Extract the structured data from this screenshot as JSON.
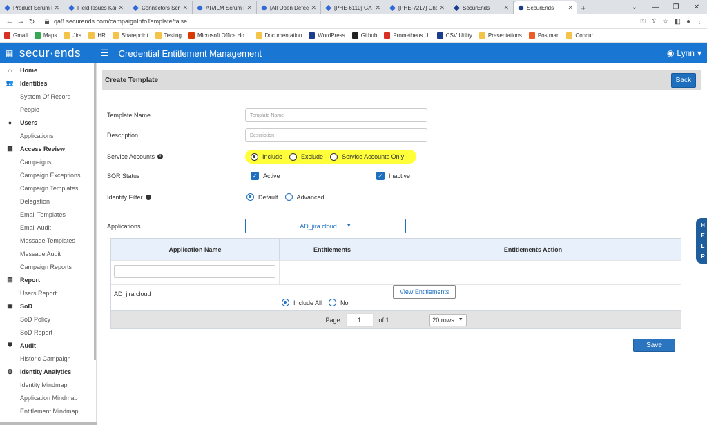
{
  "browser": {
    "tabs": [
      {
        "title": "Product Scrum B",
        "color": "#2f6bd6"
      },
      {
        "title": "Field Issues Kanb",
        "color": "#2f6bd6"
      },
      {
        "title": "Connectors Scrum",
        "color": "#2f6bd6"
      },
      {
        "title": "AR/ILM Scrum Bo",
        "color": "#2f6bd6"
      },
      {
        "title": "[All Open Defects",
        "color": "#2f6bd6"
      },
      {
        "title": "[PHE-6110] GA ar",
        "color": "#2f6bd6"
      },
      {
        "title": "[PHE-7217] Chan",
        "color": "#2f6bd6"
      },
      {
        "title": "SecurEnds",
        "color": "#1a3d8f"
      },
      {
        "title": "SecurEnds",
        "color": "#1a3d8f",
        "active": true
      }
    ],
    "new_tab": "+",
    "url": "qa8.securends.com/campaignInfoTemplate/false",
    "bookmarks": [
      {
        "label": "Gmail",
        "color": "#d93025"
      },
      {
        "label": "Maps",
        "color": "#34a853"
      },
      {
        "label": "Jira",
        "color": "#f4c34a"
      },
      {
        "label": "HR",
        "color": "#f4c34a"
      },
      {
        "label": "Sharepoint",
        "color": "#f4c34a"
      },
      {
        "label": "Testing",
        "color": "#f4c34a"
      },
      {
        "label": "Microsoft Office Ho...",
        "color": "#d83b01"
      },
      {
        "label": "Documentation",
        "color": "#f4c34a"
      },
      {
        "label": "WordPress",
        "color": "#1a3d8f"
      },
      {
        "label": "Github",
        "color": "#222222"
      },
      {
        "label": "Prometheus UI",
        "color": "#d93025"
      },
      {
        "label": "CSV Utility",
        "color": "#1a3d8f"
      },
      {
        "label": "Presentations",
        "color": "#f4c34a"
      },
      {
        "label": "Postman",
        "color": "#ef5b25"
      },
      {
        "label": "Concur",
        "color": "#f4c34a"
      }
    ]
  },
  "app": {
    "brand": "secur·ends",
    "title": "Credential Entitlement Management",
    "user": "Lynn"
  },
  "sidebar": [
    {
      "label": "Home",
      "head": true,
      "icon": "home-icon",
      "glyph": "⌂"
    },
    {
      "label": "Identities",
      "head": true,
      "icon": "users-icon",
      "glyph": "👥"
    },
    {
      "label": "System Of Record"
    },
    {
      "label": "People"
    },
    {
      "label": "Users",
      "head": true,
      "icon": "user-icon",
      "glyph": "●"
    },
    {
      "label": "Applications"
    },
    {
      "label": "Access Review",
      "head": true,
      "icon": "grid-icon",
      "glyph": "▦"
    },
    {
      "label": "Campaigns"
    },
    {
      "label": "Campaign Exceptions"
    },
    {
      "label": "Campaign Templates"
    },
    {
      "label": "Delegation"
    },
    {
      "label": "Email Templates"
    },
    {
      "label": "Email Audit"
    },
    {
      "label": "Message Templates"
    },
    {
      "label": "Message Audit"
    },
    {
      "label": "Campaign Reports"
    },
    {
      "label": "Report",
      "head": true,
      "icon": "report-icon",
      "glyph": "▤"
    },
    {
      "label": "Users Report"
    },
    {
      "label": "SoD",
      "head": true,
      "icon": "sod-icon",
      "glyph": "▣"
    },
    {
      "label": "SoD Policy"
    },
    {
      "label": "SoD Report"
    },
    {
      "label": "Audit",
      "head": true,
      "icon": "shield-icon",
      "glyph": "⛊"
    },
    {
      "label": "Historic Campaign"
    },
    {
      "label": "Identity Analytics",
      "head": true,
      "icon": "analytics-icon",
      "glyph": "◍"
    },
    {
      "label": "Identity Mindmap"
    },
    {
      "label": "Application Mindmap"
    },
    {
      "label": "Entitlement Mindmap"
    }
  ],
  "panel": {
    "title": "Create Template",
    "back": "Back"
  },
  "form": {
    "template_name_label": "Template Name",
    "template_name_placeholder": "Template Name",
    "description_label": "Description",
    "description_placeholder": "Description",
    "service_accounts_label": "Service Accounts",
    "service_options": [
      "Include",
      "Exclude",
      "Service Accounts Only"
    ],
    "sor_status_label": "SOR Status",
    "sor_active": "Active",
    "sor_inactive": "Inactive",
    "identity_filter_label": "Identity Filter",
    "identity_options": [
      "Default",
      "Advanced"
    ],
    "applications_label": "Applications",
    "applications_value": "AD_jira cloud"
  },
  "table": {
    "headers": [
      "Application Name",
      "Entitlements",
      "Entitlements Action"
    ],
    "row": {
      "name": "AD_jira cloud",
      "include_all": "Include All",
      "no": "No",
      "view": "View Entitlements"
    },
    "pager": {
      "page_label": "Page",
      "page": "1",
      "of": "of 1",
      "rows": "20 rows"
    }
  },
  "save": "Save",
  "help": [
    "H",
    "E",
    "L",
    "P"
  ],
  "colors": {
    "brand": "#1976d2",
    "highlight": "#ffff3a",
    "button": "#2b74c0"
  }
}
